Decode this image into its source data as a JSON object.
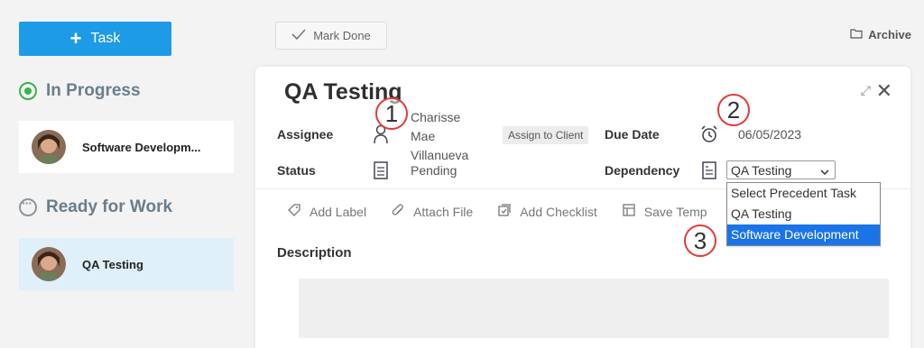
{
  "sidebar": {
    "add_task_label": "Task",
    "in_progress_title": "In Progress",
    "ready_title": "Ready for Work",
    "in_progress_tasks": [
      {
        "name": "Software Developm..."
      }
    ],
    "ready_tasks": [
      {
        "name": "QA Testing"
      }
    ]
  },
  "toolbar": {
    "mark_done_label": "Mark Done",
    "archive_label": "Archive"
  },
  "task": {
    "title": "QA Testing",
    "assignee_label": "Assignee",
    "assignee_value": "Charisse Mae Villanueva",
    "assign_to_client_label": "Assign to Client",
    "due_date_label": "Due Date",
    "due_date_value": "06/05/2023",
    "status_label": "Status",
    "status_value": "Pending",
    "dependency_label": "Dependency",
    "dependency_selected": "QA Testing",
    "dependency_options": [
      "Select Precedent Task",
      "QA Testing",
      "Software Development"
    ],
    "dependency_highlighted": "Software Development"
  },
  "actions": {
    "add_label": "Add Label",
    "attach_file": "Attach File",
    "add_checklist": "Add Checklist",
    "save_template": "Save Temp"
  },
  "description_label": "Description",
  "callouts": [
    "1",
    "2",
    "3"
  ],
  "colors": {
    "accent": "#1e9be6",
    "in_progress": "#3bb24c",
    "selected_card": "#dff0fb",
    "highlight": "#1a74e8",
    "callout": "#e53935"
  }
}
